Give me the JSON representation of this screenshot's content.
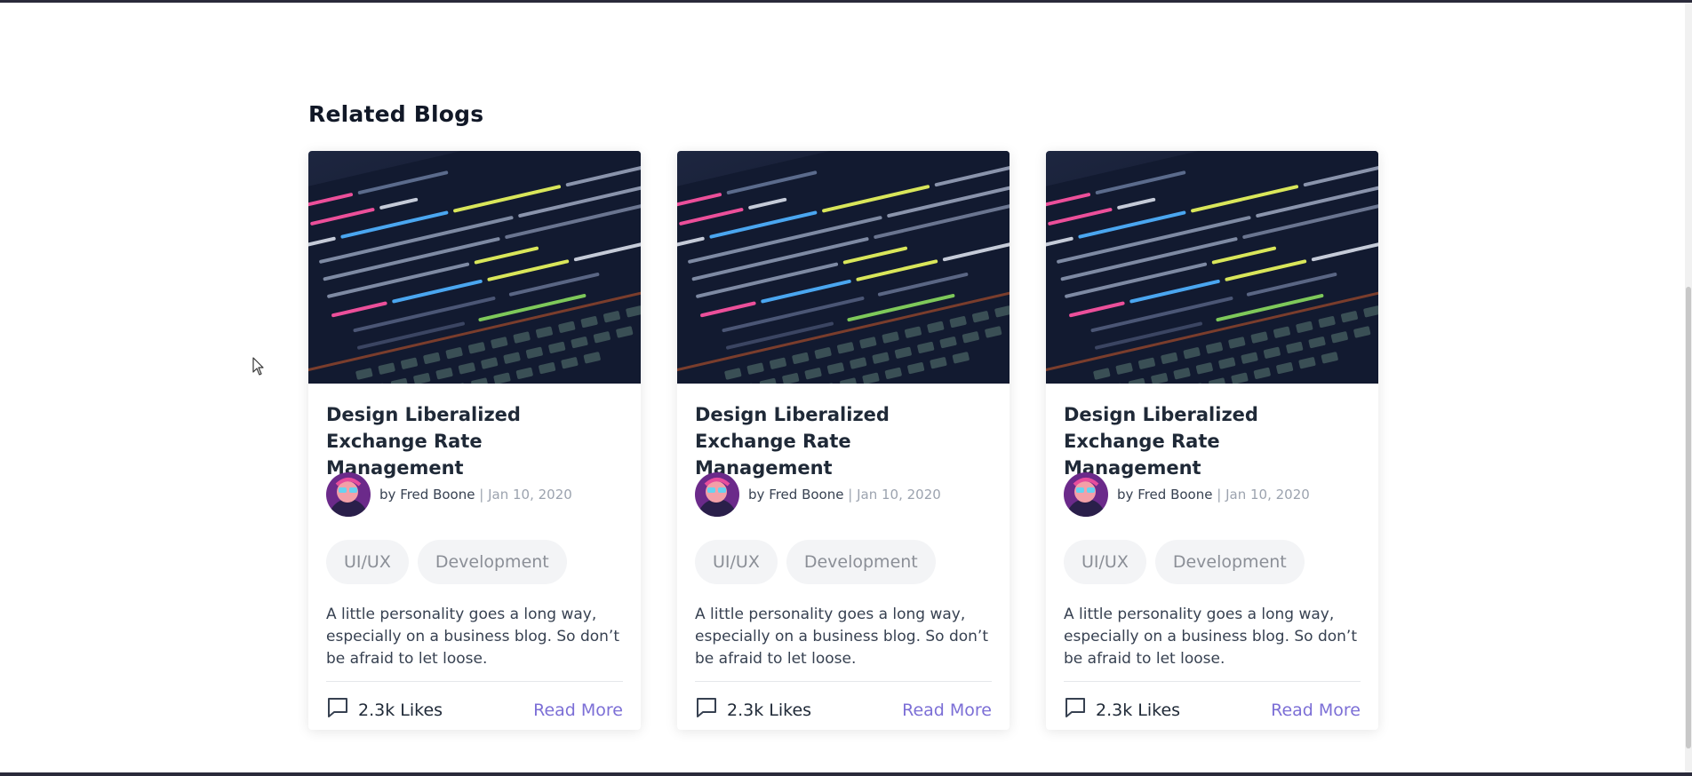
{
  "section": {
    "title": "Related Blogs"
  },
  "cards": [
    {
      "title": "Design Liberalized Exchange Rate Management",
      "by": "by",
      "author": "Fred Boone",
      "separator": "|",
      "date": "Jan 10, 2020",
      "tags": [
        "UI/UX",
        "Development"
      ],
      "excerpt": "A little personality goes a long way, especially on a business blog. So don’t be afraid to let loose.",
      "likes": "2.3k Likes",
      "read_more": "Read More"
    },
    {
      "title": "Design Liberalized Exchange Rate Management",
      "by": "by",
      "author": "Fred Boone",
      "separator": "|",
      "date": "Jan 10, 2020",
      "tags": [
        "UI/UX",
        "Development"
      ],
      "excerpt": "A little personality goes a long way, especially on a business blog. So don’t be afraid to let loose.",
      "likes": "2.3k Likes",
      "read_more": "Read More"
    },
    {
      "title": "Design Liberalized Exchange Rate Management",
      "by": "by",
      "author": "Fred Boone",
      "separator": "|",
      "date": "Jan 10, 2020",
      "tags": [
        "UI/UX",
        "Development"
      ],
      "excerpt": "A little personality goes a long way, especially on a business blog. So don’t be afraid to let loose.",
      "likes": "2.3k Likes",
      "read_more": "Read More"
    }
  ],
  "icons": {
    "comment": "comment-icon",
    "cursor": "mouse-pointer-icon"
  },
  "colors": {
    "accent": "#7c6fd6",
    "tag_bg": "#f3f4f6",
    "image_bg": "#141a2f"
  }
}
